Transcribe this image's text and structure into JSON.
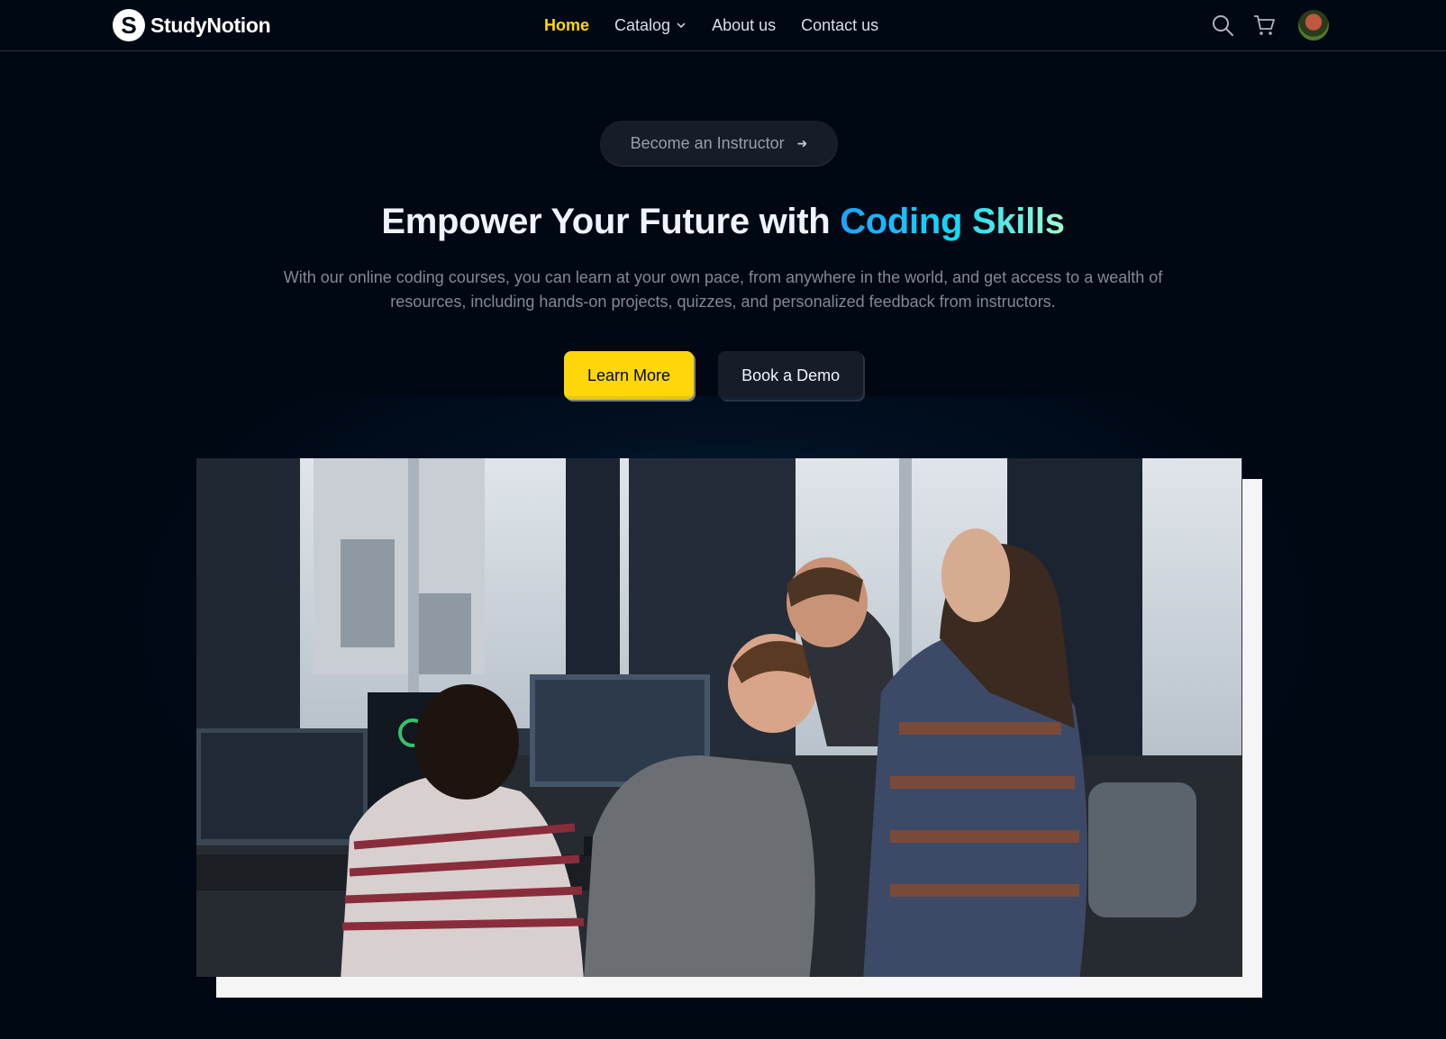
{
  "brand": {
    "name": "StudyNotion",
    "mark": "S"
  },
  "nav": {
    "links": [
      {
        "label": "Home",
        "active": true
      },
      {
        "label": "Catalog",
        "dropdown": true
      },
      {
        "label": "About us"
      },
      {
        "label": "Contact us"
      }
    ],
    "icons": [
      "search-icon",
      "cart-icon"
    ]
  },
  "hero": {
    "instructor_button": "Become an Instructor",
    "instructor_arrow": "➜",
    "headline_prefix": "Empower Your Future with",
    "headline_highlight": "Coding Skills",
    "subtext": "With our online coding courses, you can learn at your own pace, from anywhere in the world, and get access to a wealth of resources, including hands-on projects, quizzes, and personalized feedback from instructors.",
    "learn_more": "Learn More",
    "book_demo": "Book a Demo"
  },
  "colors": {
    "background": "#000814",
    "accent_yellow": "#FFD60A",
    "highlight_gradient": [
      "#1FA2FF",
      "#12D8FA",
      "#A6FFCB"
    ]
  }
}
